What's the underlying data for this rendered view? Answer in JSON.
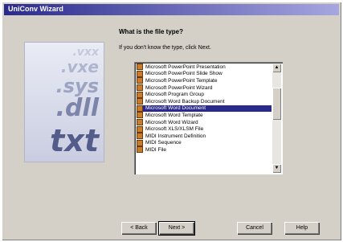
{
  "window": {
    "title": "UniConv Wizard"
  },
  "art": {
    "labels": [
      ".vxx",
      ".vxe",
      ".sys",
      ".dll",
      "txt"
    ]
  },
  "content": {
    "heading": "What is the file type?",
    "prompt": "If you don't know the type, click Next."
  },
  "file_types": {
    "items": [
      {
        "label": "Microsoft PowerPoint Presentation",
        "icon": "file-icon",
        "selected": false
      },
      {
        "label": "Microsoft PowerPoint Slide Show",
        "icon": "file-icon",
        "selected": false
      },
      {
        "label": "Microsoft PowerPoint Template",
        "icon": "file-icon",
        "selected": false
      },
      {
        "label": "Microsoft PowerPoint Wizard",
        "icon": "file-icon",
        "selected": false
      },
      {
        "label": "Microsoft Program Group",
        "icon": "file-icon",
        "selected": false
      },
      {
        "label": "Microsoft Word Backup Document",
        "icon": "file-icon",
        "selected": false
      },
      {
        "label": "Microsoft Word Document",
        "icon": "file-icon",
        "selected": true
      },
      {
        "label": "Microsoft Word Template",
        "icon": "file-icon",
        "selected": false
      },
      {
        "label": "Microsoft Word Wizard",
        "icon": "file-icon",
        "selected": false
      },
      {
        "label": "Microsoft XLS/XLSM File",
        "icon": "file-icon",
        "selected": false
      },
      {
        "label": "MIDI Instrument Definition",
        "icon": "file-icon",
        "selected": false
      },
      {
        "label": "MIDI Sequence",
        "icon": "file-icon",
        "selected": false
      },
      {
        "label": "MIDI File",
        "icon": "file-icon",
        "selected": false
      }
    ],
    "selected_index": 6
  },
  "buttons": {
    "back": "< Back",
    "next": "Next >",
    "cancel": "Cancel",
    "help": "Help"
  },
  "colors": {
    "titlebar_start": "#2a2a8c",
    "selection": "#2a2a8c",
    "dialog_face": "#d4d0c8"
  }
}
